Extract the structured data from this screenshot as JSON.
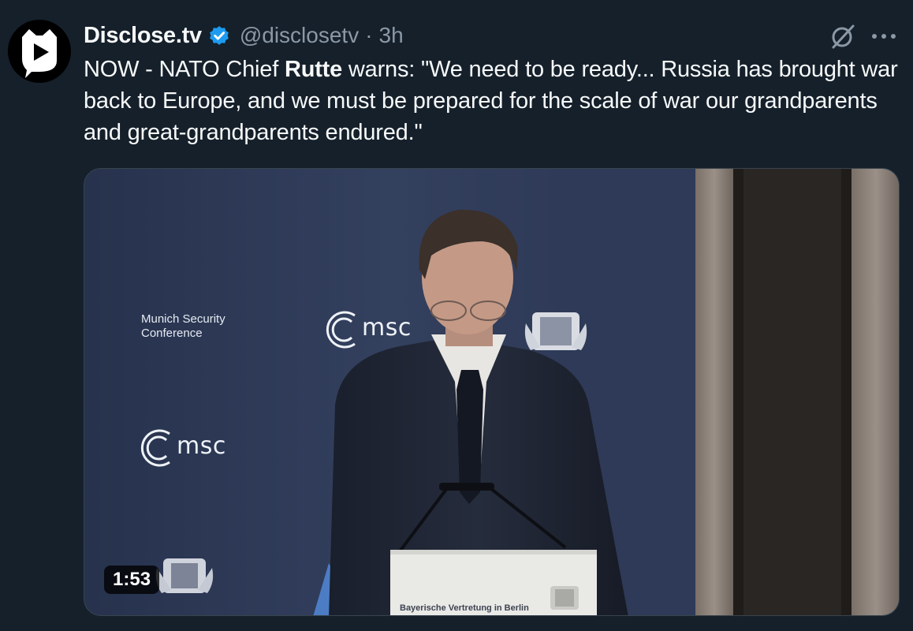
{
  "author": {
    "display_name": "Disclose.tv",
    "handle": "@disclosetv",
    "separator": "·",
    "time_ago": "3h",
    "verified": true,
    "avatar_icon": "play-mascot-icon"
  },
  "tweet": {
    "text_prefix": "NOW - NATO Chief ",
    "text_bold": "Rutte",
    "text_suffix": " warns: \"We need to be ready... Russia has brought war back to Europe, and we must be prepared for the scale of war our grandparents and great-grandparents endured.\""
  },
  "media": {
    "type": "video",
    "duration": "1:53",
    "backdrop_text_line1": "Munich Security",
    "backdrop_text_line2": "Conference",
    "logo_text_1": "msc",
    "logo_text_2": "msc",
    "lectern_text": "Bayerische Vertretung in Berlin"
  },
  "actions": {
    "grok_icon": "grok-icon",
    "more_icon": "more-options-icon"
  },
  "colors": {
    "background": "#15202b",
    "text_primary": "#f7f9f9",
    "text_secondary": "#8b98a5",
    "verified_blue": "#1d9bf0",
    "media_border": "#38444d"
  }
}
